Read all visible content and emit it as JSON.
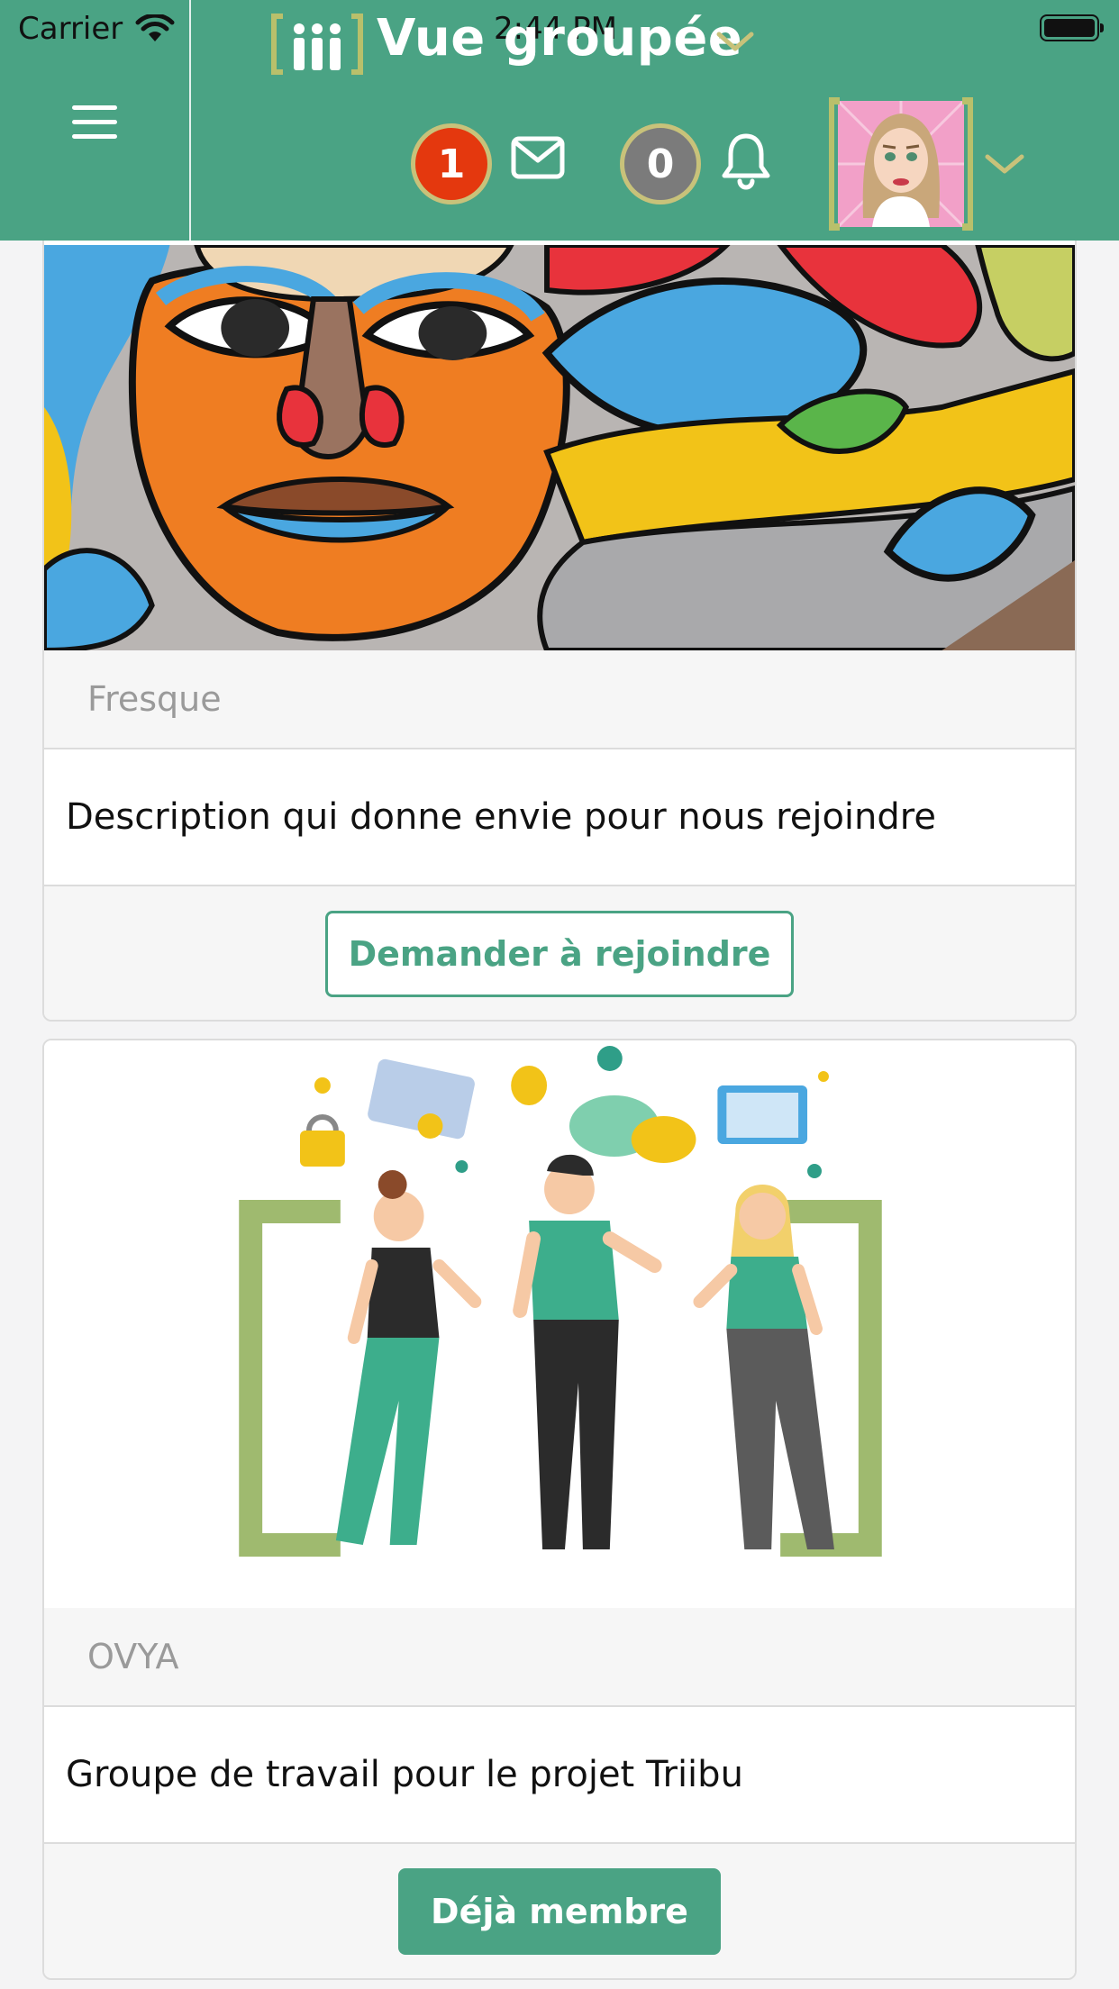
{
  "status_bar": {
    "carrier": "Carrier",
    "time": "2:44 PM"
  },
  "header": {
    "title": "Vue groupée",
    "messages_count": "1",
    "notifications_count": "0"
  },
  "groups": [
    {
      "name": "Fresque",
      "description": "Description qui donne envie pour nous rejoindre",
      "action_label": "Demander à rejoindre"
    },
    {
      "name": "OVYA",
      "description": "Groupe de travail pour le projet Triibu",
      "action_label": "Déjà membre"
    }
  ],
  "icons": {
    "menu": "hamburger-icon",
    "messages": "envelope-icon",
    "notifications": "bell-icon",
    "title_dropdown": "chevron-down-icon",
    "profile_dropdown": "chevron-down-icon"
  },
  "colors": {
    "brand_green": "#4aa384",
    "badge_red": "#e4380e",
    "badge_grey": "#7b7b7b",
    "badge_ring": "#c8c27a",
    "logo_bracket": "#b9c06b"
  }
}
